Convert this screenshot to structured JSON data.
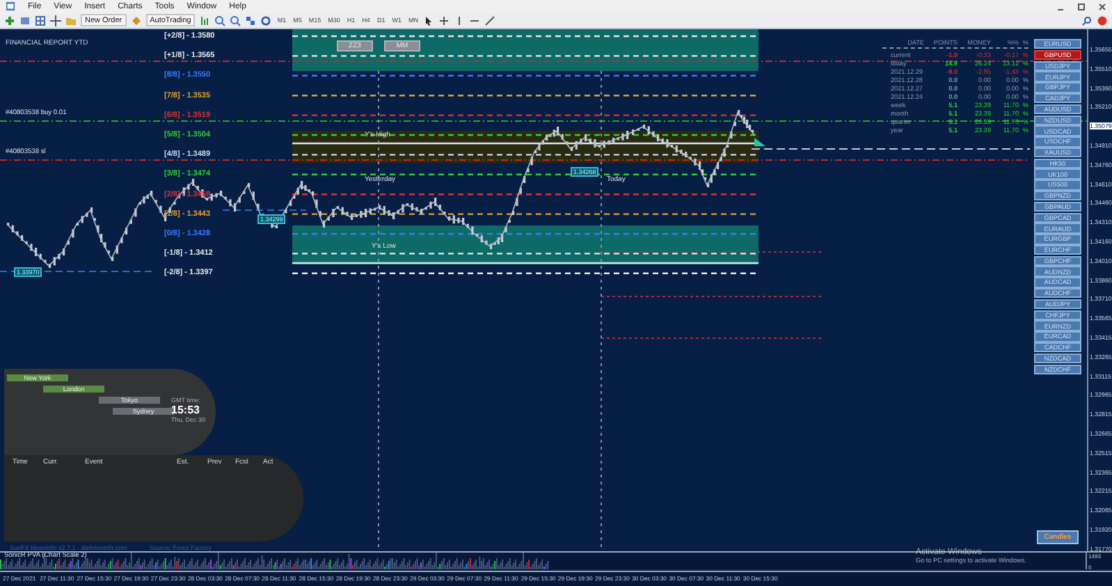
{
  "menu": [
    "File",
    "View",
    "Insert",
    "Charts",
    "Tools",
    "Window",
    "Help"
  ],
  "toolbar": {
    "new_order": "New Order",
    "auto_trading": "AutoTrading",
    "timeframes": [
      "M1",
      "M5",
      "M15",
      "M30",
      "H1",
      "H4",
      "D1",
      "W1",
      "MN"
    ]
  },
  "chart": {
    "title": "FINANCIAL REPORT YTD",
    "buttons": [
      "ZZ3",
      "MM"
    ],
    "order_labels": [
      "#40803538 buy 0.01",
      "#40803538 sl"
    ],
    "murrey_levels": [
      {
        "label": "[+2/8] - 1.3580",
        "color": "#e8e8e8"
      },
      {
        "label": "[+1/8] - 1.3565",
        "color": "#e8e8e8"
      },
      {
        "label": "[8/8] - 1.3550",
        "color": "#3a7bff"
      },
      {
        "label": "[7/8] - 1.3535",
        "color": "#e0a030"
      },
      {
        "label": "[6/8] - 1.3519",
        "color": "#e03030"
      },
      {
        "label": "[5/8] - 1.3504",
        "color": "#30d030"
      },
      {
        "label": "[4/8] - 1.3489",
        "color": "#c8d8f0"
      },
      {
        "label": "[3/8] - 1.3474",
        "color": "#30d030"
      },
      {
        "label": "[2/8] - 1.3458",
        "color": "#e03030"
      },
      {
        "label": "[1/8] - 1.3443",
        "color": "#e0a030"
      },
      {
        "label": "[0/8] - 1.3428",
        "color": "#3a7bff"
      },
      {
        "label": "[-1/8] - 1.3412",
        "color": "#e8e8e8"
      },
      {
        "label": "[-2/8] - 1.3397",
        "color": "#e8e8e8"
      }
    ],
    "annotations": [
      "Y's High",
      "Yesterday",
      "Today",
      "Y's Low"
    ],
    "price_tags": [
      "1.34299",
      "1.33970",
      "1.34268"
    ],
    "report": {
      "columns": [
        "DATE",
        "POINTS",
        "MONEY",
        "%%",
        "%"
      ],
      "rows": [
        {
          "date": "current",
          "points": "-1.0",
          "money": "-0.33",
          "percent": "-0.17",
          "unit": "%",
          "color": "#e02828"
        },
        {
          "date": "today",
          "points": "14.9",
          "money": "26.24",
          "percent": "13.12",
          "unit": "%",
          "color": "#22dd22"
        },
        {
          "date": "2021.12.29",
          "points": "-9.0",
          "money": "-2.85",
          "percent": "-1.43",
          "unit": "%",
          "color": "#e02828"
        },
        {
          "date": "2021.12.28",
          "points": "0.0",
          "money": "0.00",
          "percent": "0.00",
          "unit": "%",
          "color": "#8a9ab0"
        },
        {
          "date": "2021.12.27",
          "points": "0.0",
          "money": "0.00",
          "percent": "0.00",
          "unit": "%",
          "color": "#8a9ab0"
        },
        {
          "date": "2021.12.24",
          "points": "0.0",
          "money": "0.00",
          "percent": "0.00",
          "unit": "%",
          "color": "#8a9ab0"
        },
        {
          "date": "week",
          "points": "5.1",
          "money": "23.39",
          "percent": "11.70",
          "unit": "%",
          "color": "#22dd22"
        },
        {
          "date": "month",
          "points": "5.1",
          "money": "23.39",
          "percent": "11.70",
          "unit": "%",
          "color": "#22dd22"
        },
        {
          "date": "quarter",
          "points": "5.1",
          "money": "23.39",
          "percent": "11.70",
          "unit": "%",
          "color": "#22dd22"
        },
        {
          "date": "year",
          "points": "5.1",
          "money": "23.39",
          "percent": "11.70",
          "unit": "%",
          "color": "#22dd22"
        }
      ]
    },
    "symbols": [
      {
        "label": "EURUSD",
        "selected": false
      },
      {
        "label": "GBPUSD",
        "selected": true
      },
      {
        "label": "USDJPY",
        "selected": false
      },
      {
        "label": "EURJPY",
        "selected": false
      },
      {
        "label": "GBPJPY",
        "selected": false
      },
      {
        "label": "CADJPY",
        "selected": false
      },
      {
        "label": "AUDUSD",
        "selected": false
      },
      {
        "label": "NZDUSD",
        "selected": false
      },
      {
        "label": "USDCAD",
        "selected": false
      },
      {
        "label": "USDCHF",
        "selected": false
      },
      {
        "label": "XAUUSD",
        "selected": false
      },
      {
        "label": "HK50",
        "selected": false
      },
      {
        "label": "UK100",
        "selected": false
      },
      {
        "label": "US500",
        "selected": false
      },
      {
        "label": "GBPNZD",
        "selected": false
      },
      {
        "label": "GBPAUD",
        "selected": false
      },
      {
        "label": "GBPCAD",
        "selected": false
      },
      {
        "label": "EURAUD",
        "selected": false
      },
      {
        "label": "EURGBP",
        "selected": false
      },
      {
        "label": "EURCHF",
        "selected": false
      },
      {
        "label": "GBPCHF",
        "selected": false
      },
      {
        "label": "AUDNZD",
        "selected": false
      },
      {
        "label": "AUDCAD",
        "selected": false
      },
      {
        "label": "AUDCHF",
        "selected": false
      },
      {
        "label": "AUDJPY",
        "selected": false
      },
      {
        "label": "CHFJPY",
        "selected": false
      },
      {
        "label": "EURNZD",
        "selected": false
      },
      {
        "label": "EURCAD",
        "selected": false
      },
      {
        "label": "CADCHF",
        "selected": false
      },
      {
        "label": "NZDCAD",
        "selected": false
      },
      {
        "label": "NZDCHF",
        "selected": false
      }
    ],
    "candles_button": "Candles",
    "price_axis": [
      {
        "value": "1.35655",
        "current": false
      },
      {
        "value": "1.35510",
        "current": false
      },
      {
        "value": "1.35360",
        "current": false
      },
      {
        "value": "1.35210",
        "current": false
      },
      {
        "value": "1.35079",
        "current": true
      },
      {
        "value": "1.34910",
        "current": false
      },
      {
        "value": "1.34760",
        "current": false
      },
      {
        "value": "1.34610",
        "current": false
      },
      {
        "value": "1.34460",
        "current": false
      },
      {
        "value": "1.34310",
        "current": false
      },
      {
        "value": "1.34160",
        "current": false
      },
      {
        "value": "1.34010",
        "current": false
      },
      {
        "value": "1.33860",
        "current": false
      },
      {
        "value": "1.33710",
        "current": false
      },
      {
        "value": "1.33565",
        "current": false
      },
      {
        "value": "1.33415",
        "current": false
      },
      {
        "value": "1.33265",
        "current": false
      },
      {
        "value": "1.33115",
        "current": false
      },
      {
        "value": "1.32965",
        "current": false
      },
      {
        "value": "1.32815",
        "current": false
      },
      {
        "value": "1.32665",
        "current": false
      },
      {
        "value": "1.32515",
        "current": false
      },
      {
        "value": "1.32365",
        "current": false
      },
      {
        "value": "1.32215",
        "current": false
      },
      {
        "value": "1.32065",
        "current": false
      },
      {
        "value": "1.31920",
        "current": false
      },
      {
        "value": "1.31770",
        "current": false
      }
    ]
  },
  "news_panel": {
    "sessions": [
      {
        "name": "New York",
        "active": true
      },
      {
        "name": "London",
        "active": true
      },
      {
        "name": "Tokyo",
        "active": false
      },
      {
        "name": "Sydney",
        "active": false
      }
    ],
    "time_label": "GMT time:",
    "time": "15:53",
    "date": "Thu, Dec 30",
    "columns": [
      "Time",
      "Curr.",
      "Event",
      "Est.",
      "Prev",
      "Fcst",
      "Act"
    ],
    "footer": "SonFX NewsInfo v2.7.1  -  darkmoonfx.com",
    "source": "Source: Forex Factory"
  },
  "indicator": {
    "title": "SonicR PVA  (Chart Scale 2)",
    "axis": [
      "1493",
      "0"
    ]
  },
  "time_axis": [
    "27 Dec 2021",
    "27 Dec 11:30",
    "27 Dec 15:30",
    "27 Dec 19:30",
    "27 Dec 23:30",
    "28 Dec 03:30",
    "28 Dec 07:30",
    "28 Dec 11:30",
    "28 Dec 15:30",
    "28 Dec 19:30",
    "28 Dec 23:30",
    "29 Dec 03:30",
    "29 Dec 07:30",
    "29 Dec 11:30",
    "29 Dec 15:30",
    "29 Dec 19:30",
    "29 Dec 23:30",
    "30 Dec 03:30",
    "30 Dec 07:30",
    "30 Dec 11:30",
    "30 Dec 15:30"
  ],
  "activation_notice": {
    "title": "Activate Windows",
    "text": "Go to PC settings to activate Windows."
  }
}
